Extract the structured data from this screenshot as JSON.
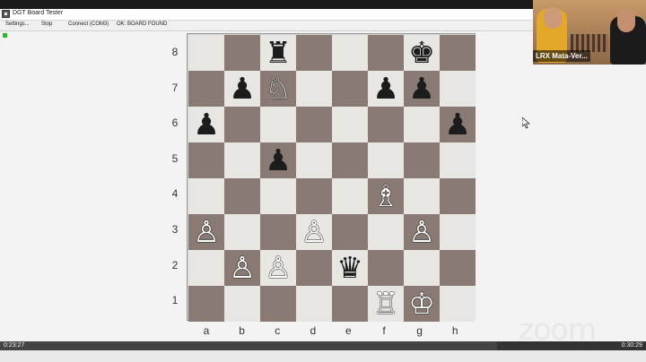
{
  "window": {
    "title": "DGT Board Tester"
  },
  "menu": [
    {
      "label": "Settings..."
    },
    {
      "label": "Stop"
    },
    {
      "label": "Connect (COM3)"
    },
    {
      "label": "OK: BOARD FOUND"
    }
  ],
  "colors": {
    "dark_square": "#8a7a74",
    "light_square": "#e8e6e3",
    "status_ok": "#1ec31e"
  },
  "board": {
    "ranks": [
      "8",
      "7",
      "6",
      "5",
      "4",
      "3",
      "2",
      "1"
    ],
    "files": [
      "a",
      "b",
      "c",
      "d",
      "e",
      "f",
      "g",
      "h"
    ],
    "position": [
      [
        "",
        "",
        "♜",
        "",
        "",
        "",
        "♚",
        ""
      ],
      [
        "",
        "♟",
        "♘",
        "",
        "",
        "♟",
        "♟",
        ""
      ],
      [
        "♟",
        "",
        "",
        "",
        "",
        "",
        "",
        "♟"
      ],
      [
        "",
        "",
        "♟",
        "",
        "",
        "",
        "",
        ""
      ],
      [
        "",
        "",
        "",
        "",
        "",
        "♗",
        "",
        ""
      ],
      [
        "♙",
        "",
        "",
        "♙",
        "",
        "",
        "♙",
        ""
      ],
      [
        "",
        "♙",
        "♙",
        "",
        "♛",
        "",
        "",
        ""
      ],
      [
        "",
        "",
        "",
        "",
        "",
        "♖",
        "♔",
        ""
      ]
    ]
  },
  "video": {
    "participant": "LRX Mata-Ver..."
  },
  "zoom": {
    "logo": "zoom"
  },
  "playback": {
    "elapsed": "0:23:27",
    "total": "0:30:29",
    "progress": 0.77
  }
}
